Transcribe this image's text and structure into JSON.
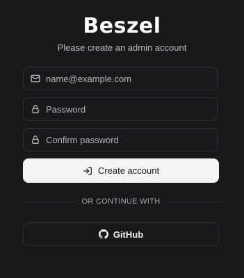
{
  "app": {
    "logo_text": "Beszel",
    "subtitle": "Please create an admin account"
  },
  "form": {
    "email": {
      "placeholder": "name@example.com",
      "value": "",
      "icon": "mail-icon"
    },
    "password": {
      "placeholder": "Password",
      "value": "",
      "icon": "lock-icon"
    },
    "confirm_password": {
      "placeholder": "Confirm password",
      "value": "",
      "icon": "lock-icon"
    },
    "submit_label": "Create account",
    "submit_icon": "log-in-icon"
  },
  "divider_text": "OR CONTINUE WITH",
  "oauth": {
    "github_label": "GitHub",
    "github_icon": "github-icon"
  },
  "colors": {
    "background": "#18191b",
    "border": "#2f3136",
    "primary_button_bg": "#f4f4f5",
    "primary_button_text": "#18191b",
    "muted_text": "#b9bbc0"
  }
}
